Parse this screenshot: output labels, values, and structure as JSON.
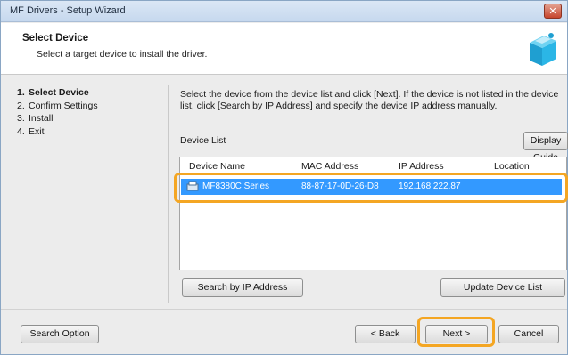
{
  "window": {
    "title": "MF Drivers - Setup Wizard",
    "close_glyph": "✕"
  },
  "header": {
    "title": "Select Device",
    "subtitle": "Select a target device to install the driver.",
    "icon": "printer-install-icon"
  },
  "steps": [
    {
      "num": "1.",
      "label": "Select Device"
    },
    {
      "num": "2.",
      "label": "Confirm Settings"
    },
    {
      "num": "3.",
      "label": "Install"
    },
    {
      "num": "4.",
      "label": "Exit"
    }
  ],
  "main": {
    "instructions": "Select the device from the device list and click [Next]. If the device is not listed in the device list, click [Search by IP Address] and specify the device IP address manually.",
    "device_list_label": "Device List",
    "display_guide_button": "Display Guide",
    "columns": [
      "Device Name",
      "MAC Address",
      "IP Address",
      "Location"
    ],
    "rows": [
      {
        "device_name": "MF8380C Series",
        "mac_address": "88-87-17-0D-26-D8",
        "ip_address": "192.168.222.87",
        "location": ""
      }
    ],
    "search_ip_button": "Search by IP Address",
    "update_list_button": "Update Device List"
  },
  "footer": {
    "search_option_button": "Search Option",
    "back_button": "< Back",
    "next_button": "Next >",
    "cancel_button": "Cancel"
  },
  "colors": {
    "selection": "#3399ff",
    "highlight": "#f4a623"
  }
}
